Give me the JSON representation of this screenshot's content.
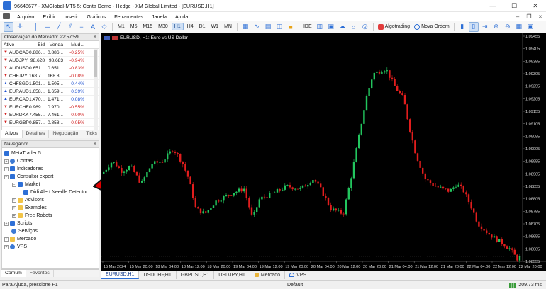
{
  "window": {
    "title": "96648677 - XMGlobal-MT5 5: Conta Demo - Hedge - XM Global Limited - [EURUSD,H1]",
    "minimize": "—",
    "maximize": "☐",
    "close": "✕"
  },
  "menu": [
    "Arquivo",
    "Exibir",
    "Inserir",
    "Gráficos",
    "Ferramentas",
    "Janela",
    "Ajuda"
  ],
  "toolbar": {
    "timeframes": [
      "M1",
      "M5",
      "M15",
      "M30",
      "H1",
      "H4",
      "D1",
      "W1",
      "MN"
    ],
    "active_timeframe": "H1",
    "ide_label": "IDE",
    "algo_label": "Algotrading",
    "new_order_label": "Nova Ordem"
  },
  "market_watch": {
    "title": "Observação do Mercado: 22:57:59",
    "columns": [
      "Ativo",
      "Bid",
      "Venda",
      "Mud..."
    ],
    "rows": [
      {
        "symbol": "AUDCAD",
        "bid": "0.886...",
        "ask": "0.886...",
        "change": "-0.25%",
        "trend": "down"
      },
      {
        "symbol": "AUDJPY",
        "bid": "98.628",
        "ask": "98.683",
        "change": "-0.94%",
        "trend": "down"
      },
      {
        "symbol": "AUDUSD",
        "bid": "0.651...",
        "ask": "0.651...",
        "change": "-0.83%",
        "trend": "down"
      },
      {
        "symbol": "CHFJPY",
        "bid": "168.7...",
        "ask": "168.8...",
        "change": "-0.08%",
        "trend": "down"
      },
      {
        "symbol": "CHFSGD",
        "bid": "1.501...",
        "ask": "1.505...",
        "change": "0.44%",
        "trend": "up"
      },
      {
        "symbol": "EURAUD",
        "bid": "1.658...",
        "ask": "1.659...",
        "change": "0.39%",
        "trend": "up"
      },
      {
        "symbol": "EURCAD",
        "bid": "1.470...",
        "ask": "1.471...",
        "change": "0.08%",
        "trend": "up"
      },
      {
        "symbol": "EURCHF",
        "bid": "0.969...",
        "ask": "0.970...",
        "change": "-0.55%",
        "trend": "down"
      },
      {
        "symbol": "EURDKK",
        "bid": "7.455...",
        "ask": "7.461...",
        "change": "-0.00%",
        "trend": "down"
      },
      {
        "symbol": "EURGBP",
        "bid": "0.857...",
        "ask": "0.858...",
        "change": "-0.05%",
        "trend": "down"
      }
    ],
    "tabs": [
      "Ativos",
      "Detalhes",
      "Negociação",
      "Ticks"
    ]
  },
  "navigator": {
    "title": "Navegador",
    "items": [
      {
        "label": "MetaTrader 5"
      },
      {
        "label": "Contas"
      },
      {
        "label": "Indicadores"
      },
      {
        "label": "Consultor expert"
      },
      {
        "label": "Market"
      },
      {
        "label": "Didi Alert Needle Detector"
      },
      {
        "label": "Advisors"
      },
      {
        "label": "Examples"
      },
      {
        "label": "Free Robots"
      },
      {
        "label": "Scripts"
      },
      {
        "label": "Serviços"
      },
      {
        "label": "Mercado"
      },
      {
        "label": "VPS"
      }
    ],
    "tabs": [
      "Comum",
      "Favoritos"
    ]
  },
  "chart": {
    "title": "EURUSD, H1:  Euro vs US Dollar",
    "price_labels": [
      "1.09455",
      "1.09405",
      "1.09355",
      "1.09305",
      "1.09255",
      "1.09205",
      "1.09155",
      "1.09105",
      "1.09055",
      "1.09005",
      "1.08955",
      "1.08905",
      "1.08855",
      "1.08805",
      "1.08755",
      "1.08705",
      "1.08655",
      "1.08605",
      "1.08555"
    ],
    "time_labels": [
      "15 Mar 2024",
      "15 Mar 20:00",
      "18 Mar 04:00",
      "18 Mar 12:00",
      "18 Mar 20:00",
      "19 Mar 04:00",
      "19 Mar 12:00",
      "19 Mar 20:00",
      "20 Mar 04:00",
      "20 Mar 12:00",
      "20 Mar 20:00",
      "21 Mar 04:00",
      "21 Mar 12:00",
      "21 Mar 20:00",
      "22 Mar 04:00",
      "22 Mar 12:00",
      "22 Mar 20:00"
    ],
    "up_color": "#22c55e",
    "down_color": "#e11d1d"
  },
  "chart_tabs": [
    "EURUSD,H1",
    "USDCHF,H1",
    "GBPUSD,H1",
    "USDJPY,H1",
    "Mercado",
    "VPS"
  ],
  "status": {
    "help": "Para Ajuda, pressione F1",
    "profile": "Default",
    "ping": "209.73 ms"
  }
}
